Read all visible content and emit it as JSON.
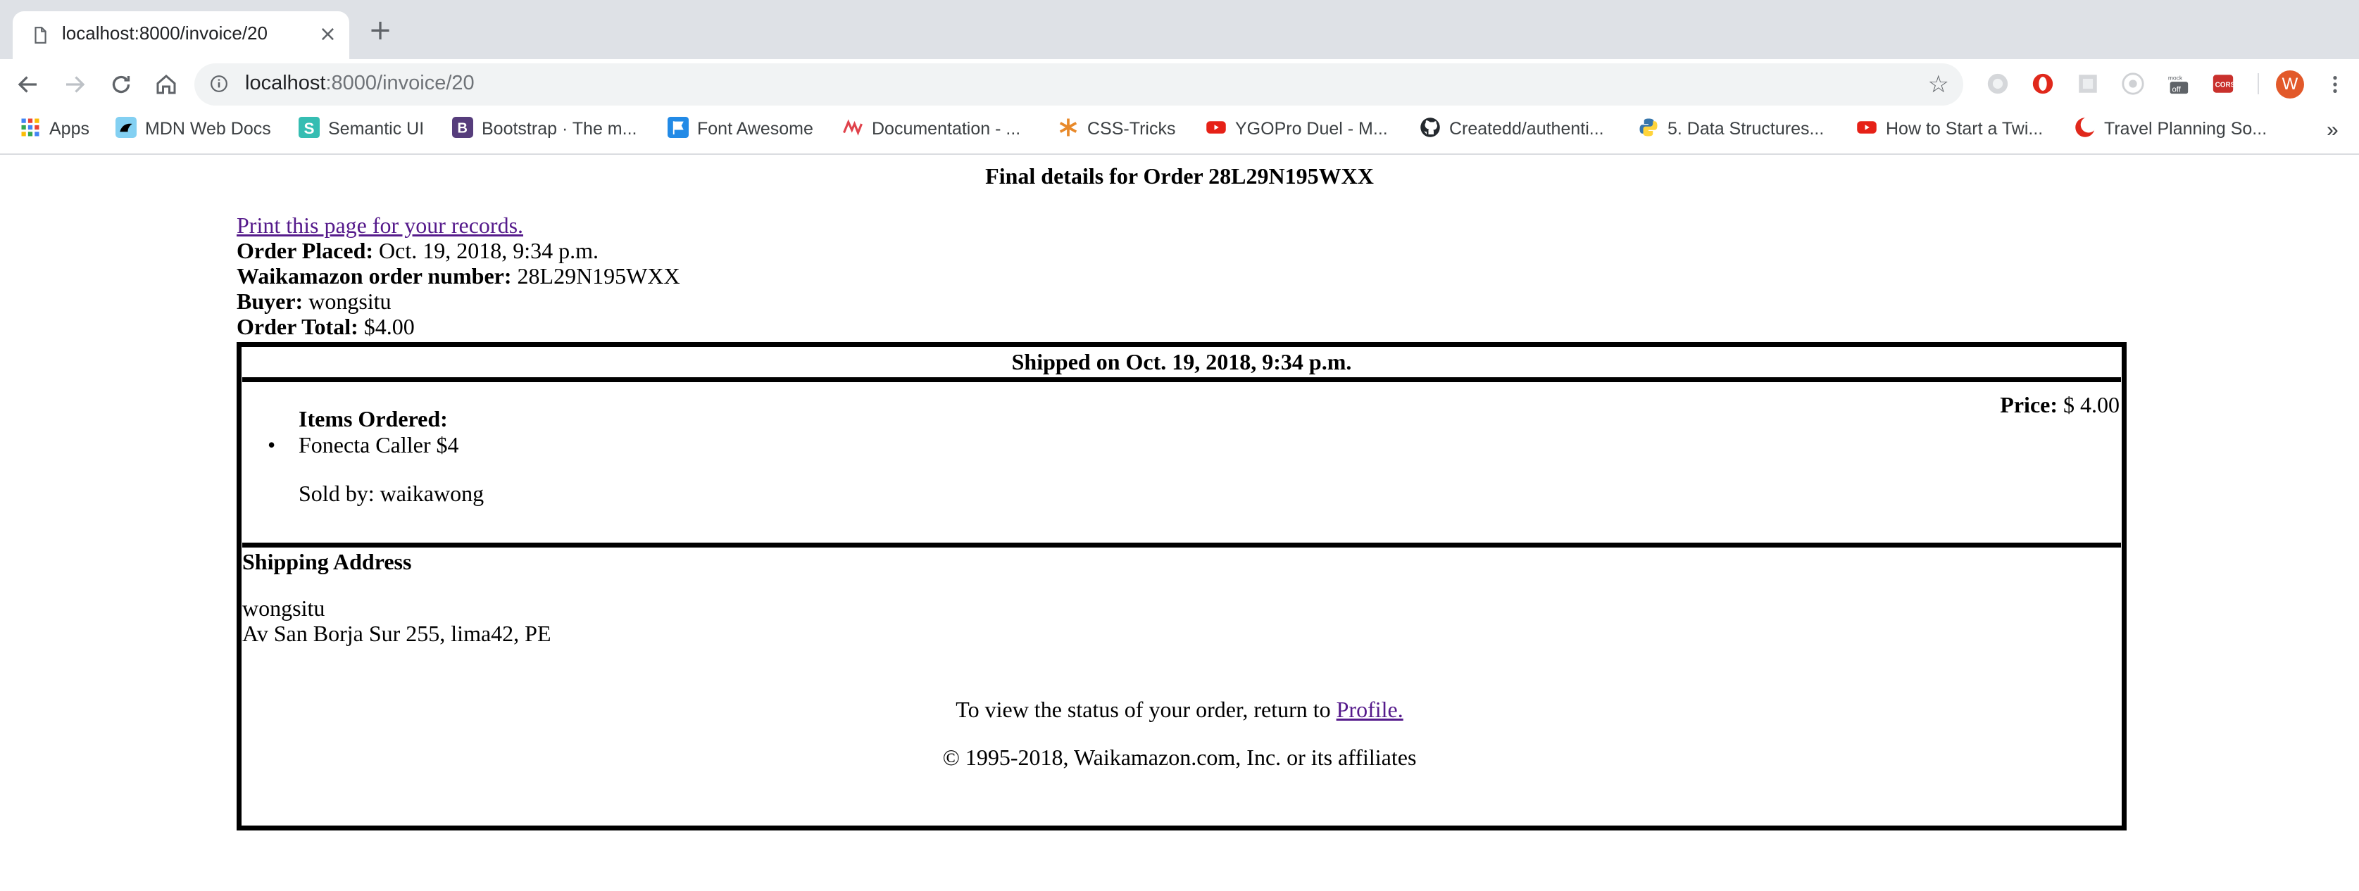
{
  "browser": {
    "tab": {
      "title": "localhost:8000/invoice/20",
      "close": "×"
    },
    "new_tab": "+",
    "url": {
      "host": "localhost",
      "rest": ":8000/invoice/20"
    },
    "profile_initial": "W",
    "more_bookmarks": "»",
    "bookmarks": [
      {
        "label": "Apps",
        "icon": "apps-grid-icon",
        "color": "#4285f4"
      },
      {
        "label": "MDN Web Docs",
        "icon": "mdn-icon",
        "color": "#000000"
      },
      {
        "label": "Semantic UI",
        "icon": "semantic-ui-icon",
        "color": "#35bdb2"
      },
      {
        "label": "Bootstrap · The m...",
        "icon": "bootstrap-icon",
        "color": "#563d7c"
      },
      {
        "label": "Font Awesome",
        "icon": "font-awesome-flag-icon",
        "color": "#228ae6"
      },
      {
        "label": "Documentation - ...",
        "icon": "docs-icon",
        "color": "#e0424b"
      },
      {
        "label": "CSS-Tricks",
        "icon": "css-tricks-star-icon",
        "color": "#e8892a"
      },
      {
        "label": "YGOPro Duel - M...",
        "icon": "youtube-icon",
        "color": "#e62117"
      },
      {
        "label": "Createdd/authenti...",
        "icon": "github-icon",
        "color": "#24292e"
      },
      {
        "label": "5. Data Structures...",
        "icon": "python-icon",
        "color": "#3776ab"
      },
      {
        "label": "How to Start a Twi...",
        "icon": "youtube-icon",
        "color": "#e62117"
      },
      {
        "label": "Travel Planning So...",
        "icon": "crescent-icon",
        "color": "#e0281b"
      }
    ],
    "colors": {
      "chrome_bg": "#dee1e6",
      "omnibox_bg": "#f1f3f4",
      "profile": "#e2592a"
    }
  },
  "invoice": {
    "title": "Final details for Order 28L29N195WXX",
    "print_link": "Print this page for your records.",
    "order_placed_label": "Order Placed:",
    "order_placed_value": "Oct. 19, 2018, 9:34 p.m.",
    "order_number_label": "Waikamazon order number:",
    "order_number_value": "28L29N195WXX",
    "buyer_label": "Buyer:",
    "buyer_value": "wongsitu",
    "total_label": "Order Total:",
    "total_value": "$4.00",
    "shipped_heading": "Shipped on Oct. 19, 2018, 9:34 p.m.",
    "price_label": "Price:",
    "price_value": "$ 4.00",
    "items_heading": "Items Ordered:",
    "items": [
      {
        "name": "Fonecta Caller $4",
        "sold_by": "Sold by: waikawong"
      }
    ],
    "shipping_heading": "Shipping Address",
    "shipping_name": "wongsitu",
    "shipping_address": "Av San Borja Sur 255, lima42, PE",
    "status_text": "To view the status of your order, return to",
    "profile_link": "Profile.",
    "copyright": "© 1995-2018, Waikamazon.com, Inc. or its affiliates",
    "link_color": "#551a8b"
  }
}
